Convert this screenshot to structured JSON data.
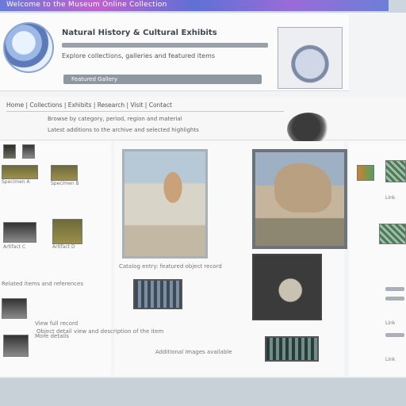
{
  "window": {
    "title_bar_label": "Welcome to the Museum Online Collection"
  },
  "header": {
    "site_title": "Natural History & Cultural Exhibits",
    "subtitle": "Explore collections, galleries and featured items",
    "tagline": "Featured Gallery"
  },
  "nav": {
    "line1": "Home | Collections | Exhibits | Research | Visit | Contact",
    "line2": "Browse by category, period, region and material",
    "line3": "Latest additions to the archive and selected highlights"
  },
  "left": {
    "items": [
      {
        "caption": "Specimen A"
      },
      {
        "caption": "Specimen B"
      },
      {
        "caption": "Artifact C"
      },
      {
        "caption": "Artifact D"
      }
    ],
    "list": [
      "Related items and references",
      "View full record",
      "More details"
    ]
  },
  "center": {
    "caption1": "Catalog entry: featured object record",
    "caption2": "Object detail view and description of the item",
    "caption3": "Additional images available"
  },
  "right": {
    "links": [
      "Link",
      "Link",
      "Link"
    ]
  },
  "colors": {
    "topbar_accent": "#6a7ad8",
    "page_background": "#f3f4f5"
  },
  "icons": [
    "logo-disc-icon",
    "badge-icon"
  ]
}
